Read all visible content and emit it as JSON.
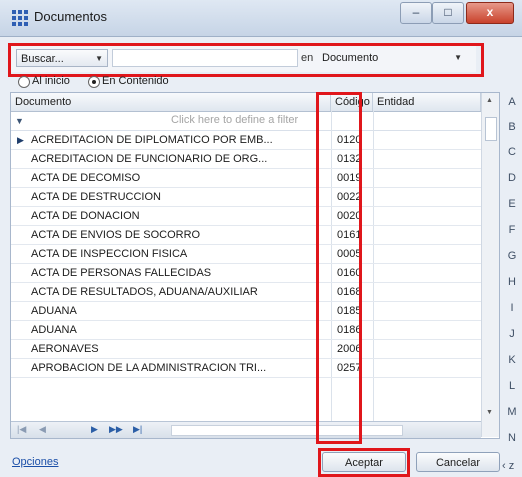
{
  "window": {
    "title": "Documentos",
    "min_glyph": "–",
    "max_glyph": "□",
    "close_glyph": "x"
  },
  "search": {
    "button_label": "Buscar...",
    "input_value": "",
    "in_label": "en",
    "field_selected": "Documento"
  },
  "options": {
    "start_label": "Al inicio",
    "content_label": "En Contenido",
    "selected": "En Contenido"
  },
  "grid": {
    "columns": [
      "Documento",
      "Código",
      "Entidad"
    ],
    "filter_placeholder": "Click here to define a filter",
    "rows": [
      {
        "documento": "ACREDITACION DE DIPLOMATICO POR EMB...",
        "codigo": "0120"
      },
      {
        "documento": "ACREDITACION DE FUNCIONARIO DE ORG...",
        "codigo": "0132"
      },
      {
        "documento": "ACTA DE DECOMISO",
        "codigo": "0019"
      },
      {
        "documento": "ACTA DE DESTRUCCION",
        "codigo": "0022"
      },
      {
        "documento": "ACTA DE DONACION",
        "codigo": "0020"
      },
      {
        "documento": "ACTA DE ENVIOS DE SOCORRO",
        "codigo": "0161"
      },
      {
        "documento": "ACTA DE INSPECCION FISICA",
        "codigo": "0005"
      },
      {
        "documento": "ACTA DE PERSONAS FALLECIDAS",
        "codigo": "0160"
      },
      {
        "documento": "ACTA DE RESULTADOS, ADUANA/AUXILIAR",
        "codigo": "0168"
      },
      {
        "documento": "ADUANA",
        "codigo": "0185"
      },
      {
        "documento": "ADUANA",
        "codigo": "0186"
      },
      {
        "documento": "AERONAVES",
        "codigo": "2006"
      },
      {
        "documento": "APROBACION DE LA ADMINISTRACION TRI...",
        "codigo": "0257"
      }
    ]
  },
  "alphabet": [
    "A",
    "B",
    "C",
    "D",
    "E",
    "F",
    "G",
    "H",
    "I",
    "J",
    "K",
    "L",
    "M",
    "N"
  ],
  "footer": {
    "options_link": "Opciones",
    "accept_label": "Aceptar",
    "cancel_label": "Cancelar",
    "corner_glyph": "‹ z"
  },
  "accent_colors": {
    "highlight_red": "#e0161b",
    "link_blue": "#1b4fa8"
  }
}
